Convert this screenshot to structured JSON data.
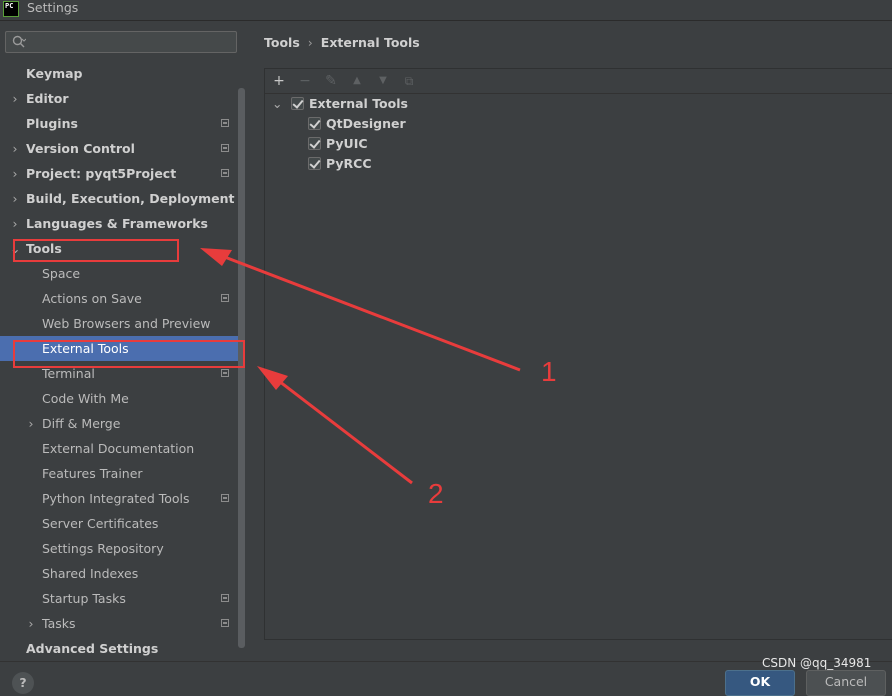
{
  "window": {
    "title": "Settings",
    "logo_text": "PC"
  },
  "sidebar": {
    "items": [
      {
        "label": "Keymap",
        "level": 0,
        "bold": true,
        "arrow": ""
      },
      {
        "label": "Editor",
        "level": 0,
        "bold": true,
        "arrow": "›"
      },
      {
        "label": "Plugins",
        "level": 0,
        "bold": true,
        "arrow": "",
        "project": true
      },
      {
        "label": "Version Control",
        "level": 0,
        "bold": true,
        "arrow": "›",
        "project": true
      },
      {
        "label": "Project: pyqt5Project",
        "level": 0,
        "bold": true,
        "arrow": "›",
        "project": true
      },
      {
        "label": "Build, Execution, Deployment",
        "level": 0,
        "bold": true,
        "arrow": "›"
      },
      {
        "label": "Languages & Frameworks",
        "level": 0,
        "bold": true,
        "arrow": "›"
      },
      {
        "label": "Tools",
        "level": 0,
        "bold": true,
        "arrow": "⌄"
      },
      {
        "label": "Space",
        "level": 1
      },
      {
        "label": "Actions on Save",
        "level": 1,
        "project": true
      },
      {
        "label": "Web Browsers and Preview",
        "level": 1
      },
      {
        "label": "External Tools",
        "level": 1,
        "selected": true
      },
      {
        "label": "Terminal",
        "level": 1,
        "project": true
      },
      {
        "label": "Code With Me",
        "level": 1
      },
      {
        "label": "Diff & Merge",
        "level": 1,
        "arrow": "›"
      },
      {
        "label": "External Documentation",
        "level": 1
      },
      {
        "label": "Features Trainer",
        "level": 1
      },
      {
        "label": "Python Integrated Tools",
        "level": 1,
        "project": true
      },
      {
        "label": "Server Certificates",
        "level": 1
      },
      {
        "label": "Settings Repository",
        "level": 1
      },
      {
        "label": "Shared Indexes",
        "level": 1
      },
      {
        "label": "Startup Tasks",
        "level": 1,
        "project": true
      },
      {
        "label": "Tasks",
        "level": 1,
        "arrow": "›",
        "project": true
      },
      {
        "label": "Advanced Settings",
        "level": 0,
        "bold": true
      }
    ]
  },
  "breadcrumb": {
    "parent": "Tools",
    "separator": "›",
    "current": "External Tools"
  },
  "toolbar": {
    "add": "+",
    "remove": "−",
    "edit": "✎",
    "up": "▲",
    "down": "▼",
    "copy": "⧉"
  },
  "tools_tree": {
    "group": "External Tools",
    "children": [
      "QtDesigner",
      "PyUIC",
      "PyRCC"
    ]
  },
  "footer": {
    "help": "?",
    "ok": "OK",
    "cancel": "Cancel"
  },
  "watermark": "CSDN @qq_34981",
  "annotations": {
    "label_1": "1",
    "label_2": "2",
    "color": "#e83c3c"
  }
}
